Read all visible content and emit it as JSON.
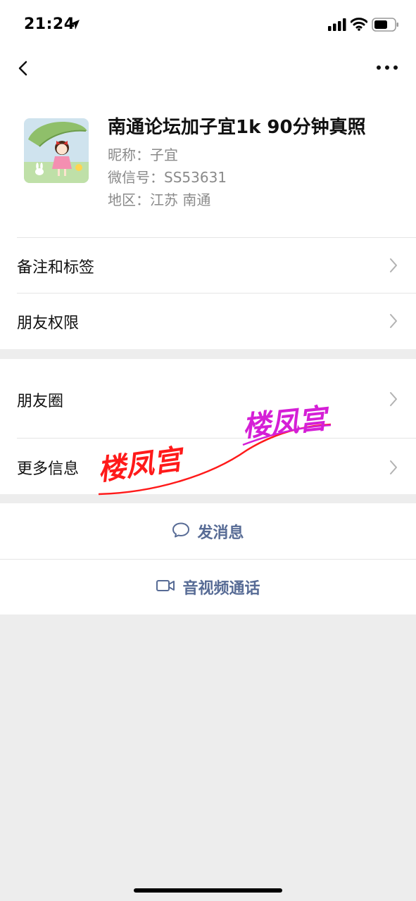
{
  "status_bar": {
    "time": "21:24",
    "icons": [
      "location-arrow-icon",
      "signal-icon",
      "wifi-icon",
      "battery-icon"
    ]
  },
  "nav": {
    "back_icon": "chevron-left-icon",
    "more_icon": "more-dots-icon"
  },
  "profile": {
    "name": "南通论坛加子宜1k 90分钟真照",
    "nickname": "昵称：子宜",
    "wechat_id": "微信号：SS53631",
    "region": "地区：江苏 南通"
  },
  "menu_group_1": [
    {
      "label": "备注和标签"
    },
    {
      "label": "朋友权限"
    }
  ],
  "menu_group_2": [
    {
      "label": "朋友圈"
    },
    {
      "label": "更多信息"
    }
  ],
  "actions": [
    {
      "label": "发消息",
      "icon": "chat-bubble-icon"
    },
    {
      "label": "音视频通话",
      "icon": "video-camera-icon"
    }
  ],
  "watermark": {
    "text_1": "楼凤宫",
    "text_2": "楼凤宫",
    "color_1": "#ff1a1a",
    "color_2": "#d51fd6"
  },
  "colors": {
    "background": "#ededed",
    "action_text": "#576b95",
    "secondary_text": "#8a8a8a"
  }
}
